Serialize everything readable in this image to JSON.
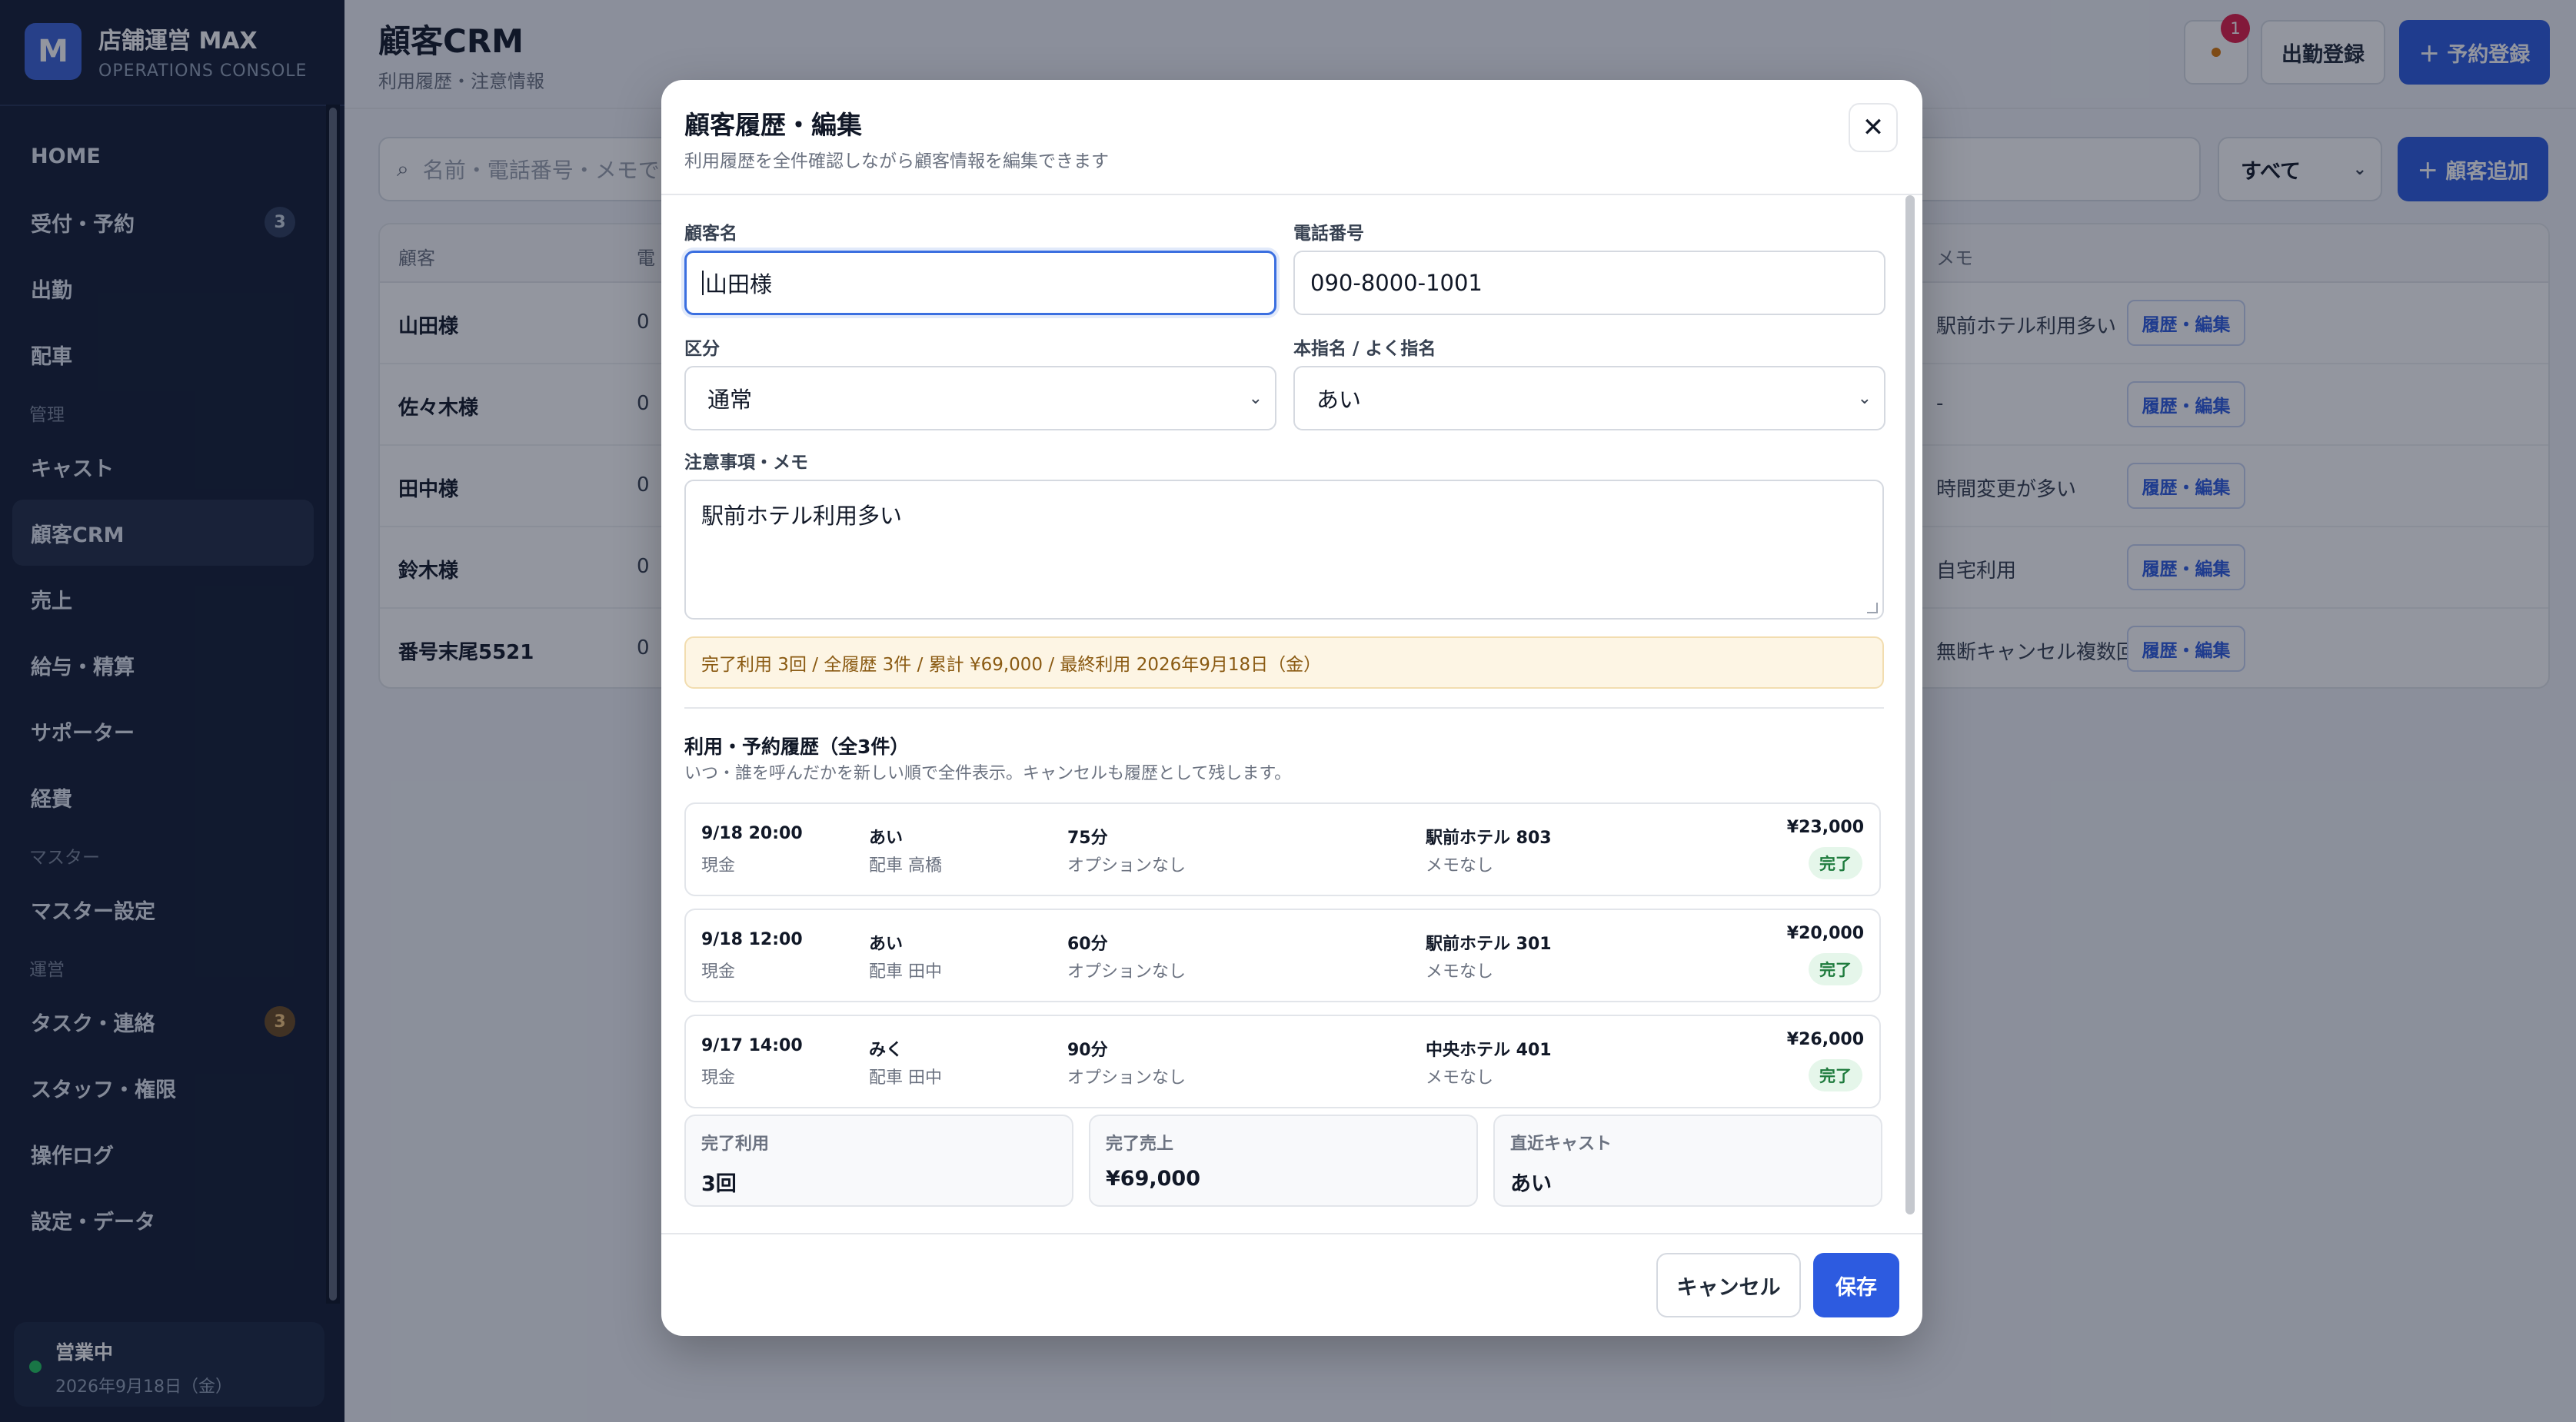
{
  "brand": {
    "logo_letter": "M",
    "name": "店舗運営 MAX",
    "sub": "OPERATIONS CONSOLE"
  },
  "sidebar": {
    "items": [
      {
        "label": "HOME"
      },
      {
        "label": "受付・予約",
        "badge": "3"
      },
      {
        "label": "出勤"
      },
      {
        "label": "配車"
      },
      {
        "section": "管理"
      },
      {
        "label": "キャスト"
      },
      {
        "label": "顧客CRM",
        "active": true
      },
      {
        "label": "売上"
      },
      {
        "label": "給与・精算"
      },
      {
        "label": "サポーター"
      },
      {
        "label": "経費"
      },
      {
        "section": "マスター"
      },
      {
        "label": "マスター設定"
      },
      {
        "section": "運営"
      },
      {
        "label": "タスク・連絡",
        "badge": "3"
      },
      {
        "label": "スタッフ・権限"
      },
      {
        "label": "操作ログ"
      },
      {
        "label": "設定・データ"
      }
    ],
    "status_title": "営業中",
    "status_date": "2026年9月18日（金）"
  },
  "header": {
    "title": "顧客CRM",
    "subtitle": "利用履歴・注意情報",
    "notif_count": "1",
    "attend_label": "出勤登録",
    "reserve_label": "＋ 予約登録"
  },
  "toolbar": {
    "search_placeholder": "名前・電話番号・メモで",
    "filter_value": "すべて",
    "add_label": "＋ 顧客追加"
  },
  "table": {
    "col_customer": "顧客",
    "col_phone_frag": "電",
    "col_memo": "メモ",
    "row_button": "履歴・編集",
    "rows": [
      {
        "name": "山田様",
        "frag": "0",
        "memo": "駅前ホテル利用多い"
      },
      {
        "name": "佐々木様",
        "frag": "0",
        "memo": "-"
      },
      {
        "name": "田中様",
        "frag": "0",
        "memo": "時間変更が多い"
      },
      {
        "name": "鈴木様",
        "frag": "0",
        "memo": "自宅利用"
      },
      {
        "name": "番号末尾5521",
        "frag": "0",
        "memo": "無断キャンセル複数回"
      }
    ]
  },
  "modal": {
    "title": "顧客履歴・編集",
    "subtitle": "利用履歴を全件確認しながら顧客情報を編集できます",
    "close": "✕",
    "name_label": "顧客名",
    "name_value": "山田様",
    "phone_label": "電話番号",
    "phone_value": "090-8000-1001",
    "class_label": "区分",
    "class_value": "通常",
    "nomination_label": "本指名 / よく指名",
    "nomination_value": "あい",
    "memo_label": "注意事項・メモ",
    "memo_value": "駅前ホテル利用多い",
    "summary": "完了利用 3回 / 全履歴 3件 / 累計 ¥69,000 / 最終利用 2026年9月18日（金）",
    "history_title": "利用・予約履歴（全3件）",
    "history_sub": "いつ・誰を呼んだかを新しい順で全件表示。キャンセルも履歴として残します。",
    "history": [
      {
        "datetime": "9/18 20:00",
        "payment": "現金",
        "cast": "あい",
        "driver": "配車 高橋",
        "duration": "75分",
        "option": "オプションなし",
        "place": "駅前ホテル 803",
        "memo": "メモなし",
        "amount": "¥23,000",
        "status": "完了"
      },
      {
        "datetime": "9/18 12:00",
        "payment": "現金",
        "cast": "あい",
        "driver": "配車 田中",
        "duration": "60分",
        "option": "オプションなし",
        "place": "駅前ホテル 301",
        "memo": "メモなし",
        "amount": "¥20,000",
        "status": "完了"
      },
      {
        "datetime": "9/17 14:00",
        "payment": "現金",
        "cast": "みく",
        "driver": "配車 田中",
        "duration": "90分",
        "option": "オプションなし",
        "place": "中央ホテル 401",
        "memo": "メモなし",
        "amount": "¥26,000",
        "status": "完了"
      }
    ],
    "stats": [
      {
        "label": "完了利用",
        "value": "3回"
      },
      {
        "label": "完了売上",
        "value": "¥69,000"
      },
      {
        "label": "直近キャスト",
        "value": "あい"
      }
    ],
    "cancel_label": "キャンセル",
    "save_label": "保存"
  },
  "colors": {
    "primary": "#2d5be0",
    "sidebar": "#131d33",
    "success": "#22c55e",
    "notice_bg": "#fdf5e4"
  },
  "icons": {
    "search": "search-icon",
    "close": "close-icon",
    "bell": "bell-icon",
    "chevron": "chevron-down-icon"
  }
}
